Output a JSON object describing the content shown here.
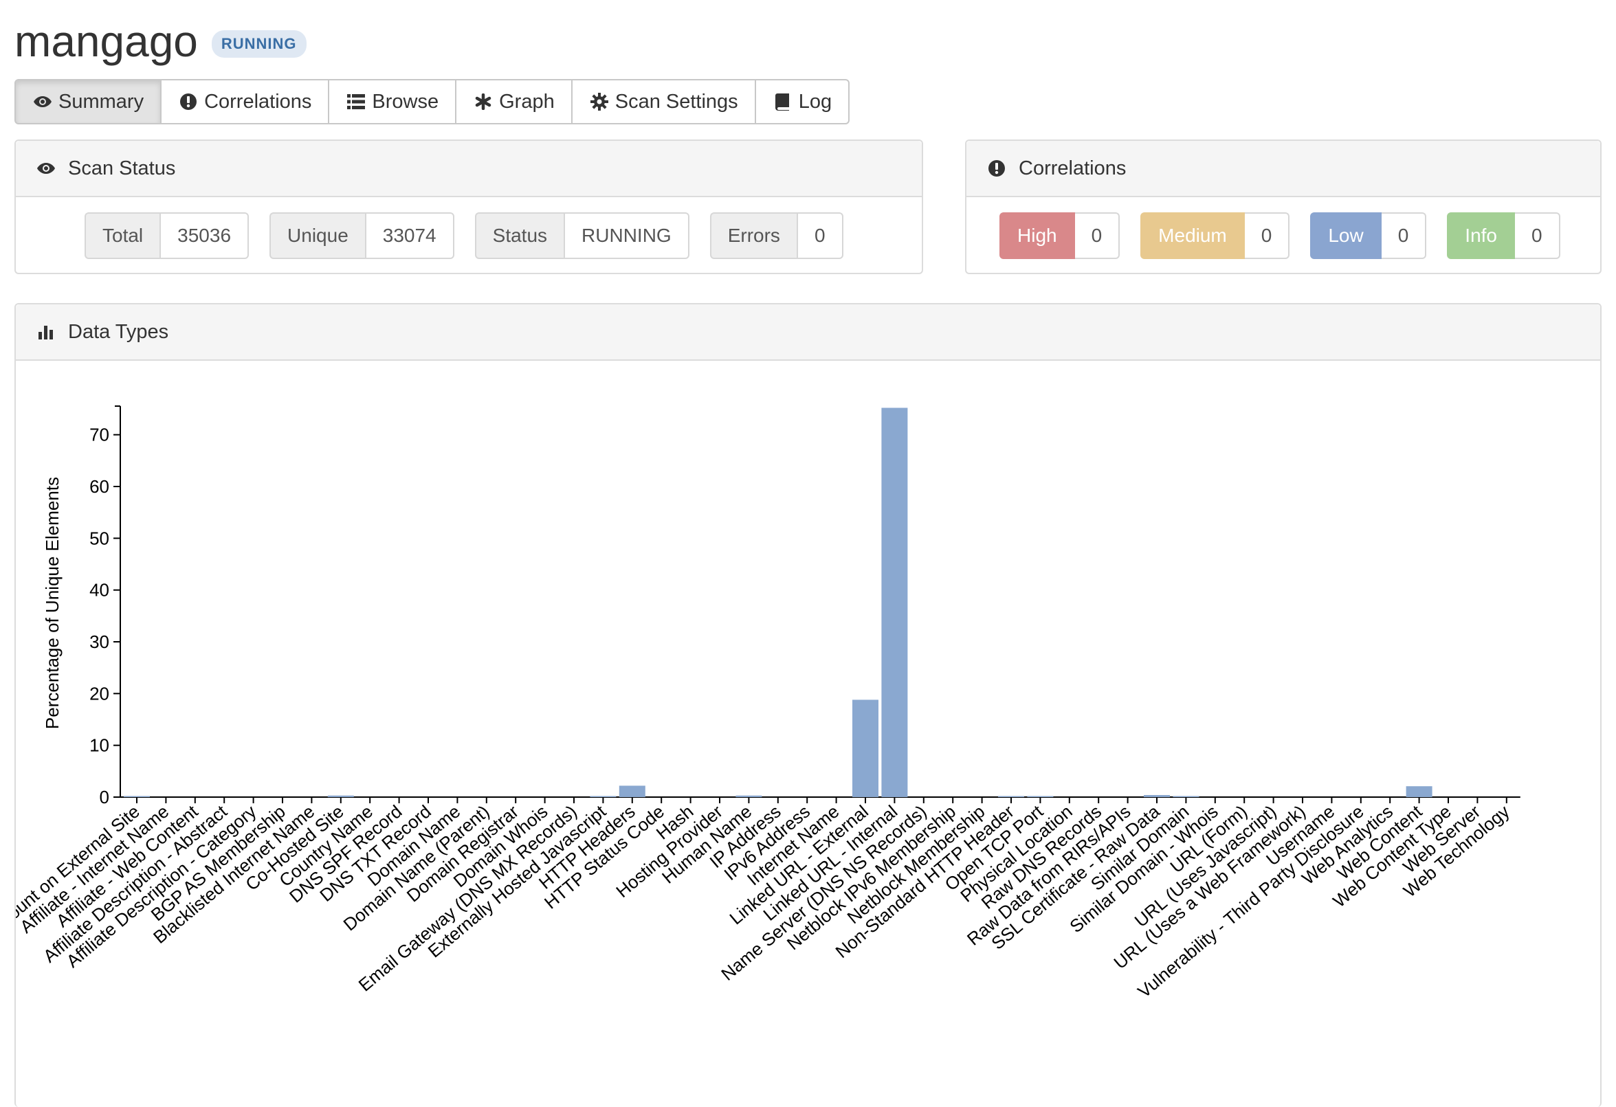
{
  "app": {
    "title": "mangago",
    "status_badge": "RUNNING"
  },
  "tabs": [
    {
      "label": "Summary",
      "icon": "eye-icon",
      "active": true
    },
    {
      "label": "Correlations",
      "icon": "exclamation-circle-icon"
    },
    {
      "label": "Browse",
      "icon": "list-icon"
    },
    {
      "label": "Graph",
      "icon": "asterisk-icon"
    },
    {
      "label": "Scan Settings",
      "icon": "gear-icon"
    },
    {
      "label": "Log",
      "icon": "book-icon"
    }
  ],
  "scan_status": {
    "title": "Scan Status",
    "icon": "eye-icon",
    "stats": [
      {
        "label": "Total",
        "value": "35036"
      },
      {
        "label": "Unique",
        "value": "33074"
      },
      {
        "label": "Status",
        "value": "RUNNING"
      },
      {
        "label": "Errors",
        "value": "0"
      }
    ]
  },
  "correlations": {
    "title": "Correlations",
    "icon": "exclamation-circle-icon",
    "items": [
      {
        "label": "High",
        "count": "0",
        "color": "#d9888a"
      },
      {
        "label": "Medium",
        "count": "0",
        "color": "#e8c98f"
      },
      {
        "label": "Low",
        "count": "0",
        "color": "#8aa5d0"
      },
      {
        "label": "Info",
        "count": "0",
        "color": "#a3cf94"
      }
    ]
  },
  "data_types": {
    "title": "Data Types",
    "icon": "bar-chart-icon"
  },
  "chart_data": {
    "type": "bar",
    "title": "",
    "xlabel": "",
    "ylabel": "Percentage of Unique Elements",
    "ylim": [
      0,
      75
    ],
    "yticks": [
      0,
      10,
      20,
      30,
      40,
      50,
      60,
      70
    ],
    "bar_color": "#8aa8d0",
    "grid": false,
    "categories": [
      "Account on External Site",
      "Affiliate - Internet Name",
      "Affiliate - Web Content",
      "Affiliate Description - Abstract",
      "Affiliate Description - Category",
      "BGP AS Membership",
      "Blacklisted Internet Name",
      "Co-Hosted Site",
      "Country Name",
      "DNS SPF Record",
      "DNS TXT Record",
      "Domain Name",
      "Domain Name (Parent)",
      "Domain Registrar",
      "Domain Whois",
      "Email Gateway (DNS MX Records)",
      "Externally Hosted Javascript",
      "HTTP Headers",
      "HTTP Status Code",
      "Hash",
      "Hosting Provider",
      "Human Name",
      "IP Address",
      "IPv6 Address",
      "Internet Name",
      "Linked URL - External",
      "Linked URL - Internal",
      "Name Server (DNS NS Records)",
      "Netblock IPv6 Membership",
      "Netblock Membership",
      "Non-Standard HTTP Header",
      "Open TCP Port",
      "Physical Location",
      "Raw DNS Records",
      "Raw Data from RIRs/APIs",
      "SSL Certificate - Raw Data",
      "Similar Domain",
      "Similar Domain - Whois",
      "URL (Form)",
      "URL (Uses Javascript)",
      "URL (Uses a Web Framework)",
      "Username",
      "Vulnerability - Third Party Disclosure",
      "Web Analytics",
      "Web Content",
      "Web Content Type",
      "Web Server",
      "Web Technology"
    ],
    "values": [
      0.2,
      0,
      0,
      0,
      0,
      0,
      0,
      0.3,
      0,
      0,
      0,
      0,
      0,
      0,
      0,
      0,
      0.1,
      2.2,
      0,
      0,
      0,
      0.3,
      0,
      0,
      0,
      18.8,
      75.2,
      0,
      0,
      0,
      0.1,
      0.1,
      0,
      0,
      0,
      0.4,
      0.2,
      0,
      0,
      0,
      0,
      0,
      0,
      0,
      2.1,
      0,
      0,
      0
    ]
  }
}
